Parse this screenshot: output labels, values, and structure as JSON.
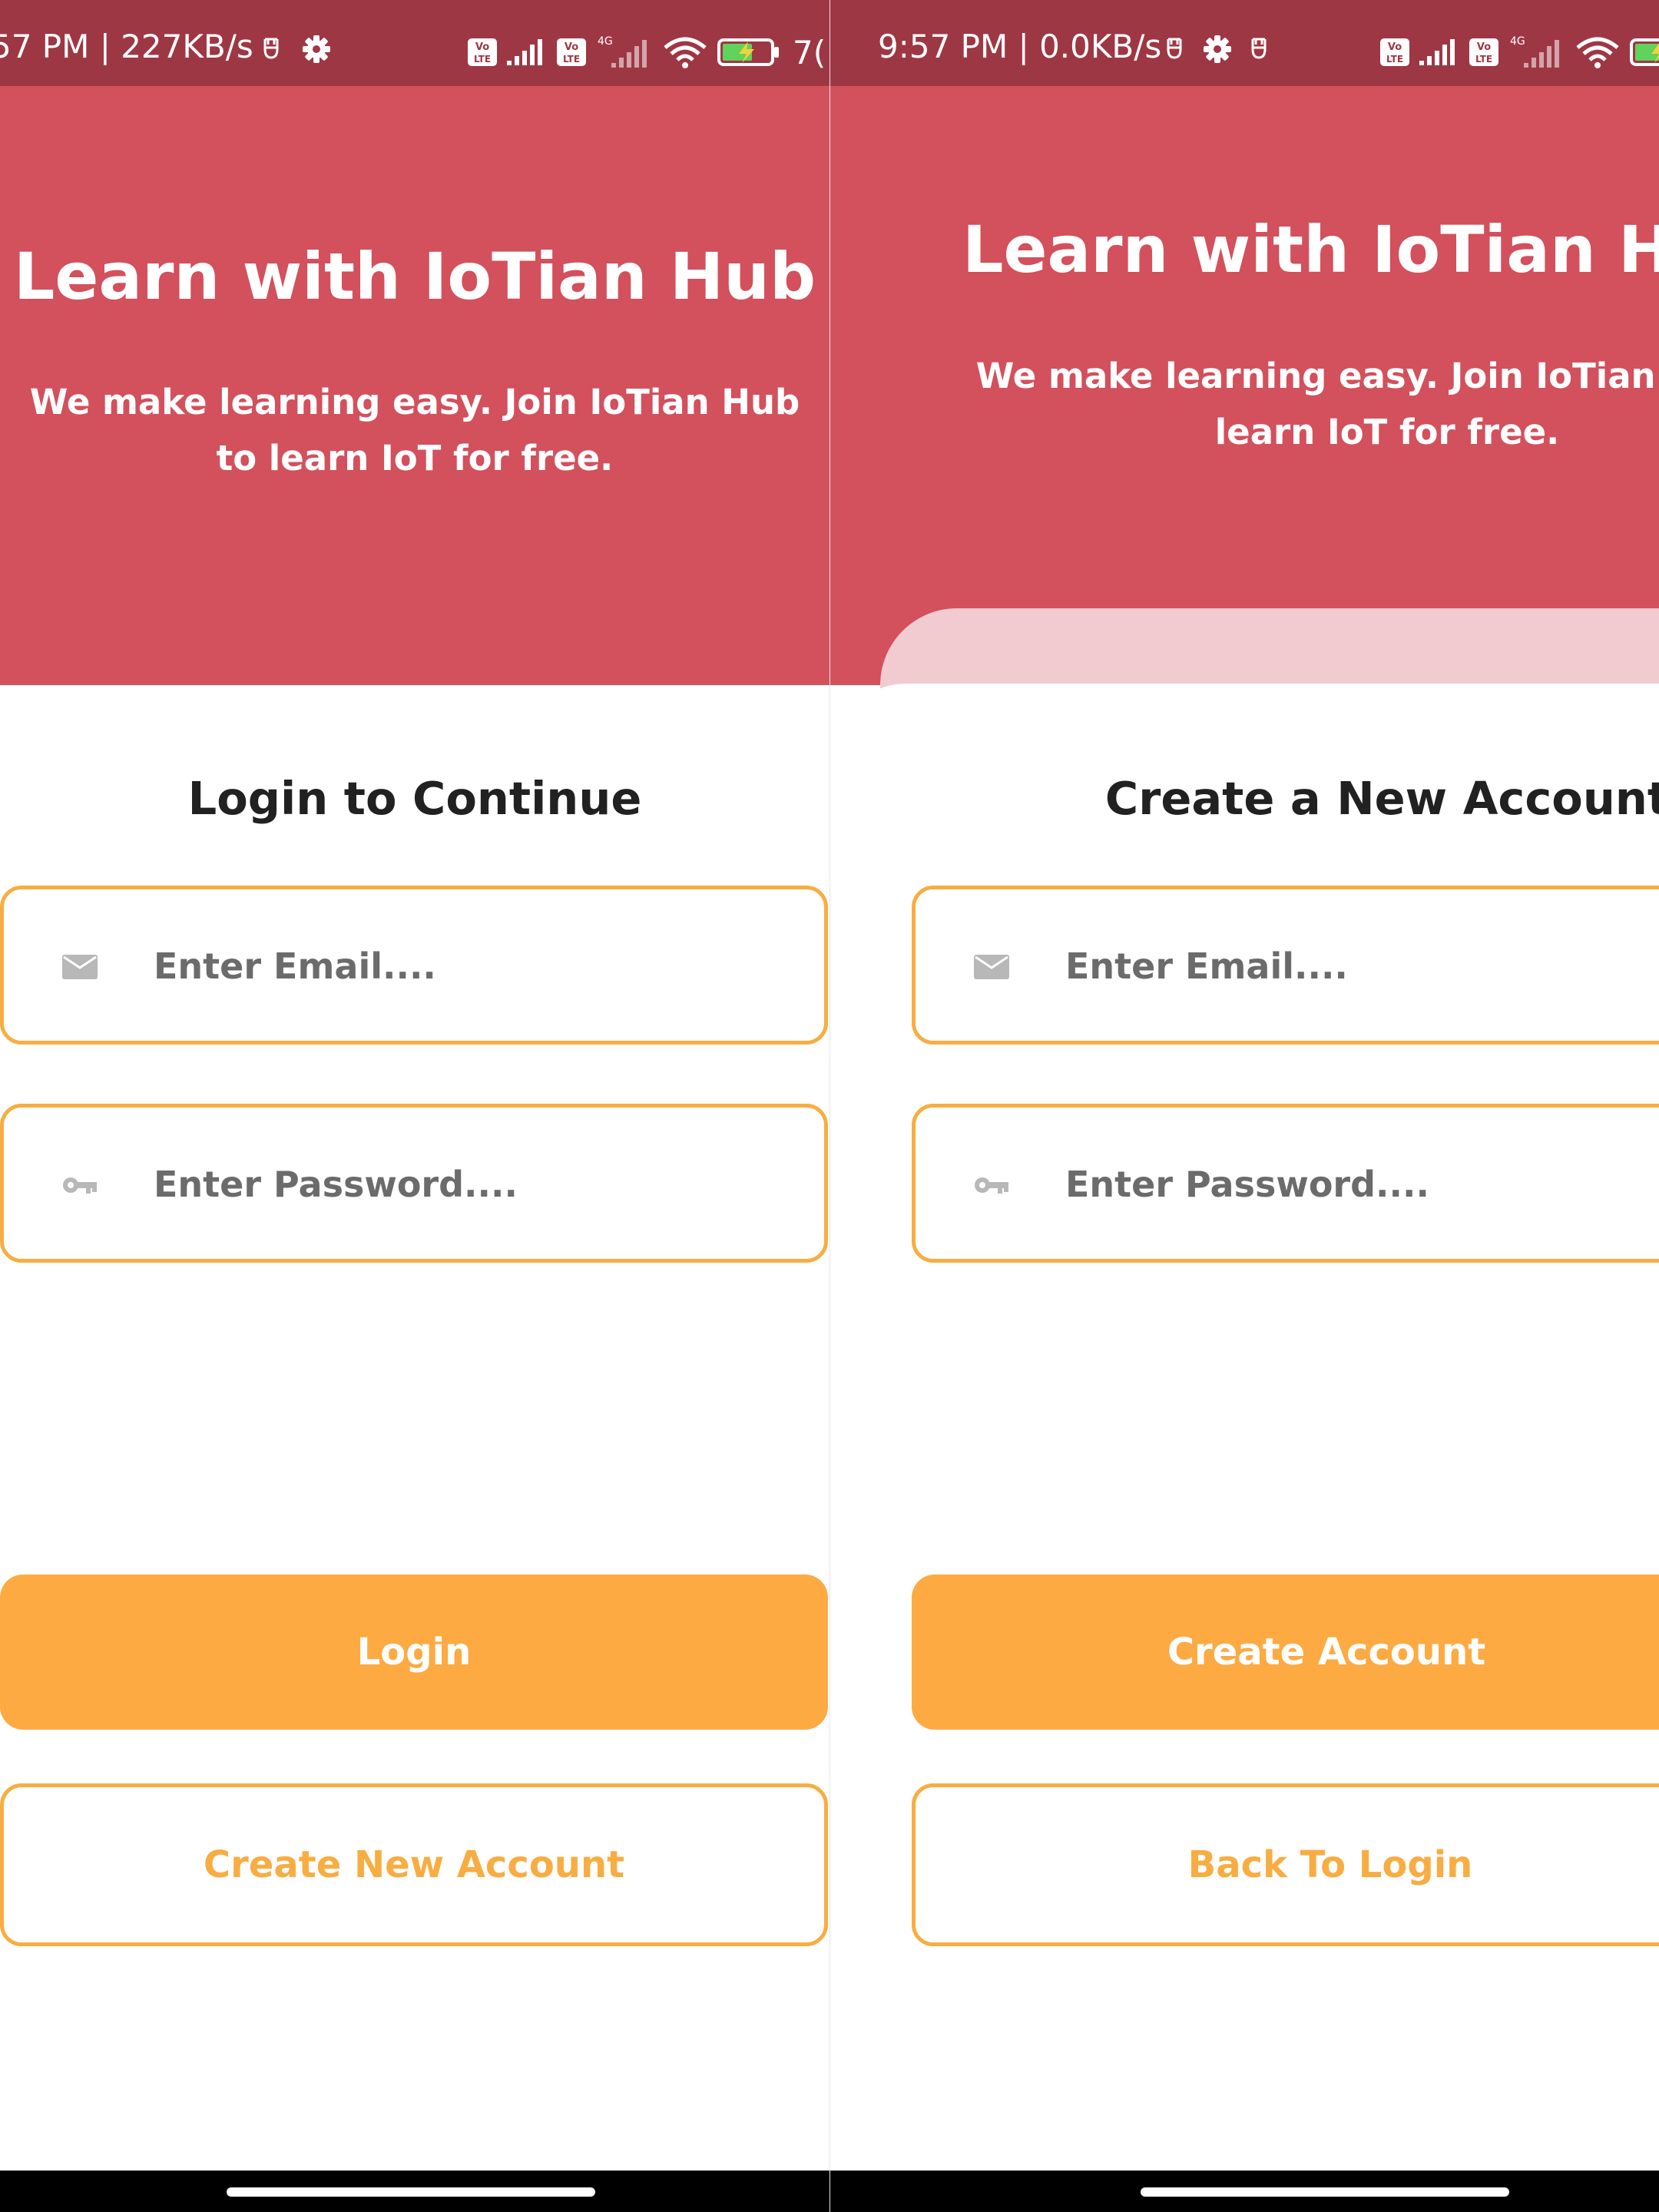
{
  "colors": {
    "status_bar": "#9e3744",
    "hero": "#d3505d",
    "hero_wave": "#f2cbd0",
    "accent": "#f8ad42",
    "primary_button": "#fdaa42",
    "heading_text": "#212121",
    "nav_bar": "#000000"
  },
  "login_screen": {
    "status_bar": {
      "time_text": "57 PM | 227KB/s",
      "right_text": "7(",
      "icons": [
        "usb-debug-icon",
        "settings-gear-icon",
        "volte-icon",
        "signal-icon",
        "4g-icon",
        "wifi-icon",
        "battery-charging-icon"
      ]
    },
    "hero": {
      "title": "Learn with IoTian Hub",
      "subtitle": "We make learning easy. Join IoTian Hub to learn IoT for free."
    },
    "heading": "Login to Continue",
    "email_field": {
      "placeholder": "Enter Email....",
      "icon": "email-icon"
    },
    "password_field": {
      "placeholder": "Enter Password....",
      "icon": "key-icon"
    },
    "primary_button": "Login",
    "secondary_button": "Create New Account"
  },
  "signup_screen": {
    "status_bar": {
      "time_text": "9:57 PM | 0.0KB/s",
      "icons": [
        "usb-debug-icon",
        "settings-gear-icon",
        "usb-debug-icon",
        "volte-icon",
        "signal-icon",
        "4g-icon",
        "wifi-icon",
        "battery-charging-icon"
      ]
    },
    "hero": {
      "title": "Learn with IoTian Hub",
      "subtitle": "We make learning easy. Join IoTian Hub to learn IoT for free."
    },
    "heading": "Create a New Account",
    "email_field": {
      "placeholder": "Enter Email....",
      "icon": "email-icon"
    },
    "password_field": {
      "placeholder": "Enter Password....",
      "icon": "key-icon"
    },
    "primary_button": "Create Account",
    "secondary_button": "Back To Login"
  }
}
